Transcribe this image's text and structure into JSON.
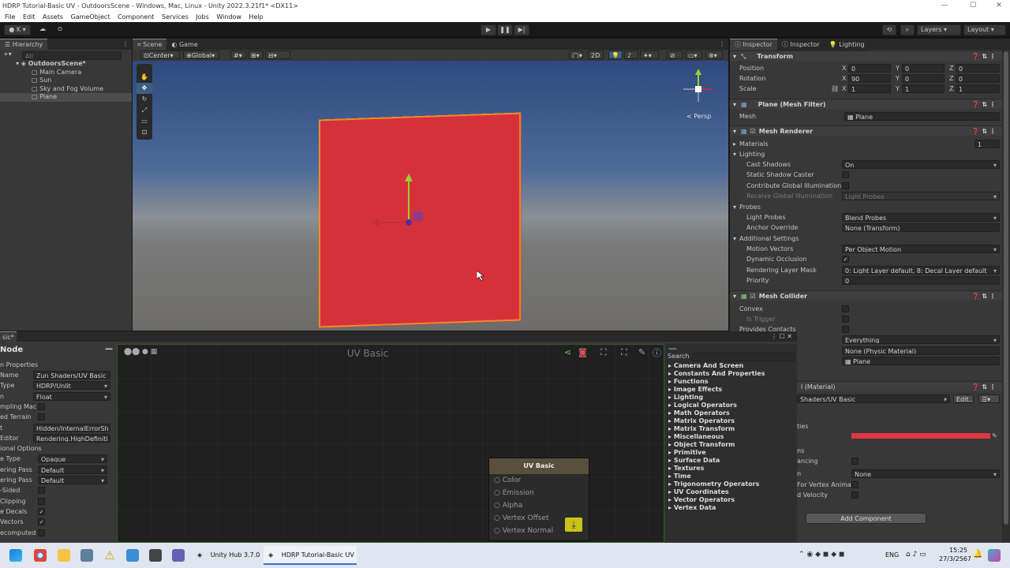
{
  "window": {
    "title": "HDRP Tutorial-Basic UV - OutdoorsScene - Windows, Mac, Linux - Unity 2022.3.21f1* <DX11>"
  },
  "menu": [
    "File",
    "Edit",
    "Assets",
    "GameObject",
    "Component",
    "Services",
    "Jobs",
    "Window",
    "Help"
  ],
  "toolbar": {
    "account": "K",
    "layers": "Layers",
    "layout": "Layout"
  },
  "hierarchy": {
    "tab": "Hierarchy",
    "search_placeholder": "All",
    "scene": "OutdoorsScene*",
    "items": [
      "Main Camera",
      "Sun",
      "Sky and Fog Volume",
      "Plane"
    ]
  },
  "scene": {
    "tabs": [
      "Scene",
      "Game"
    ],
    "pivot": "Center",
    "space": "Global",
    "mode2d": "2D",
    "persp": "< Persp"
  },
  "inspector": {
    "tabs": [
      "Inspector",
      "Inspector",
      "Lighting"
    ],
    "transform": {
      "title": "Transform",
      "position_label": "Position",
      "rotation_label": "Rotation",
      "scale_label": "Scale",
      "px": "0",
      "py": "0",
      "pz": "0",
      "rx": "90",
      "ry": "0",
      "rz": "0",
      "sx": "1",
      "sy": "1",
      "sz": "1"
    },
    "meshfilter": {
      "title": "Plane (Mesh Filter)",
      "mesh_label": "Mesh",
      "mesh": "Plane"
    },
    "meshrenderer": {
      "title": "Mesh Renderer",
      "materials": "Materials",
      "materials_count": "1",
      "lighting": "Lighting",
      "cast_shadows": "Cast Shadows",
      "cast_shadows_val": "On",
      "static_shadow": "Static Shadow Caster",
      "gi": "Contribute Global Illumination",
      "receive_gi": "Receive Global Illumination",
      "receive_gi_val": "Light Probes",
      "probes": "Probes",
      "light_probes": "Light Probes",
      "light_probes_val": "Blend Probes",
      "anchor": "Anchor Override",
      "anchor_val": "None (Transform)",
      "additional": "Additional Settings",
      "motion": "Motion Vectors",
      "motion_val": "Per Object Motion",
      "dyn_occ": "Dynamic Occlusion",
      "rlm": "Rendering Layer Mask",
      "rlm_val": "0: Light Layer default, 8: Decal Layer default",
      "priority": "Priority",
      "priority_val": "0"
    },
    "meshcollider": {
      "title": "Mesh Collider",
      "convex": "Convex",
      "trigger": "Is Trigger",
      "contacts": "Provides Contacts",
      "layer_val": "Everything",
      "material_val": "None (Physic Material)",
      "mesh_val": "Plane"
    },
    "material": {
      "title": "l (Material)",
      "shader": "Shaders/UV Basic",
      "edit": "Edit...",
      "props": "ties",
      "ns": "ns",
      "instancing": "ancing",
      "none": "None",
      "vertex_anim": "For Vertex Animati",
      "velocity": "d Velocity",
      "add_component": "Add Component"
    }
  },
  "shadergraph": {
    "tab": "sic*",
    "node_title": "Node",
    "props_header": "n Properties",
    "rows": [
      {
        "k": "Name",
        "v": "Zun Shaders/UV Basic"
      },
      {
        "k": "Type",
        "v": "HDRP/Unlit",
        "dd": true
      },
      {
        "k": "n",
        "v": "Float",
        "dd": true
      },
      {
        "k": "mpling Mac",
        "v": ""
      },
      {
        "k": "ed Terrain",
        "v": ""
      },
      {
        "k": "t",
        "v": "Hidden/InternalErrorSh"
      },
      {
        "k": "Editor",
        "v": "Rendering.HighDefiniti"
      },
      {
        "k": "ional Options",
        "v": ""
      },
      {
        "k": "e Type",
        "v": "Opaque",
        "dd": true
      },
      {
        "k": "ering Pass",
        "v": "Default",
        "dd": true
      },
      {
        "k": "ering Pass",
        "v": "Default",
        "dd": true
      },
      {
        "k": "-Sided",
        "v": ""
      },
      {
        "k": "Clipping",
        "v": ""
      },
      {
        "k": "e Decals",
        "v": "✓"
      },
      {
        "k": "Vectors",
        "v": "✓"
      },
      {
        "k": "ecomputed",
        "v": ""
      }
    ],
    "graph_title": "UV Basic",
    "master": {
      "title": "UV Basic",
      "ports": [
        "Color",
        "Emission",
        "Alpha",
        "Vertex Offset",
        "Vertex Normal"
      ]
    },
    "search_label": "Search",
    "categories": [
      "Camera And Screen",
      "Constants And Properties",
      "Functions",
      "Image Effects",
      "Lighting",
      "Logical Operators",
      "Math Operators",
      "Matrix Operators",
      "Matrix Transform",
      "Miscellaneous",
      "Object Transform",
      "Primitive",
      "Surface Data",
      "Textures",
      "Time",
      "Trigonometry Operators",
      "UV Coordinates",
      "Vector Operators",
      "Vertex Data"
    ]
  },
  "taskbar": {
    "apps": [
      "Unity Hub 3.7.0",
      "HDRP Tutorial-Basic UV"
    ],
    "lang": "ENG",
    "time": "15:25",
    "date": "27/3/2567"
  },
  "colors": {
    "plane": "#d6313b",
    "outline": "#f08a2a",
    "material_color": "#e0363f"
  }
}
